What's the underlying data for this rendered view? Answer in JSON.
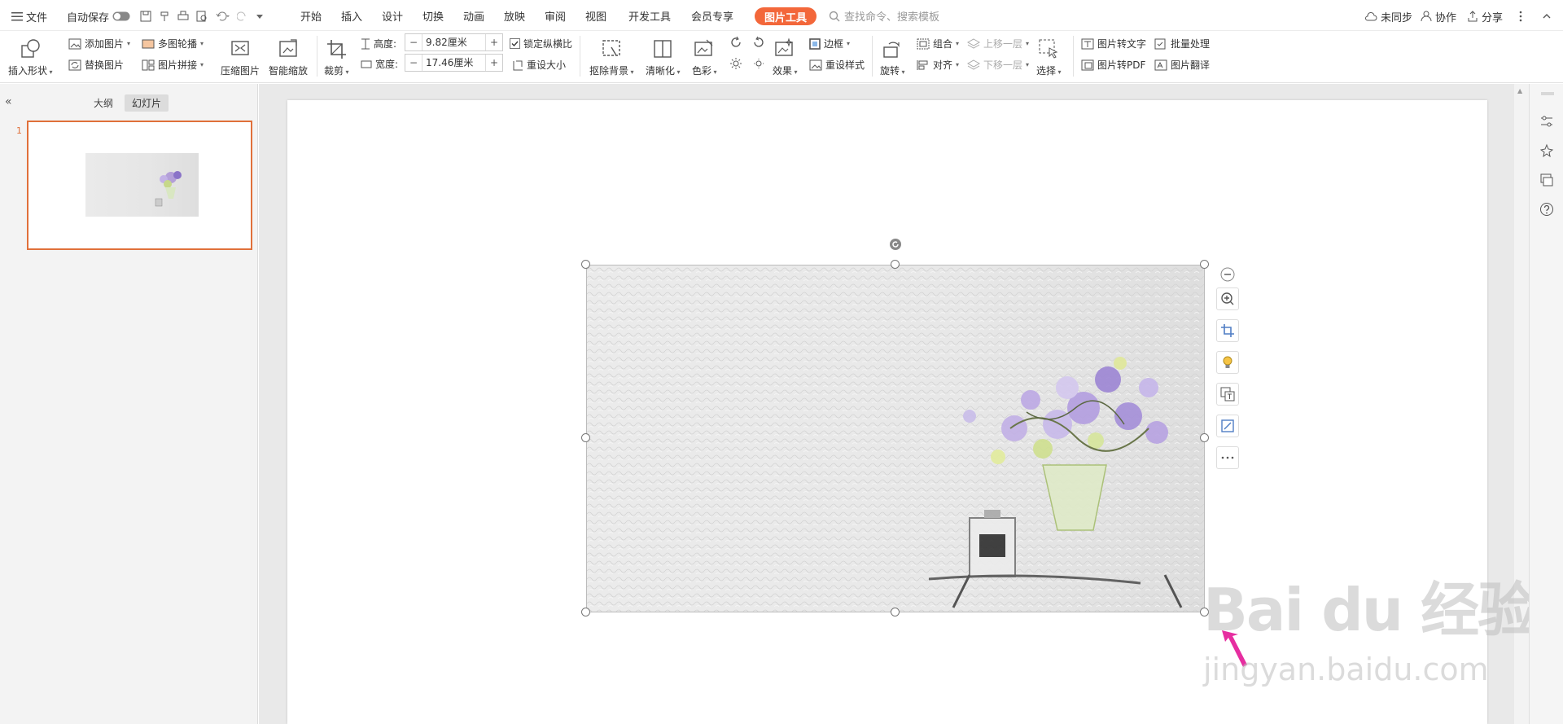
{
  "topbar": {
    "menu_label": "文件",
    "autosave_label": "自动保存",
    "tabs": [
      "开始",
      "插入",
      "设计",
      "切换",
      "动画",
      "放映",
      "审阅",
      "视图",
      "开发工具",
      "会员专享"
    ],
    "active_tab": "图片工具",
    "search_placeholder": "查找命令、搜索模板",
    "sync_label": "未同步",
    "collab_label": "协作",
    "share_label": "分享"
  },
  "ribbon": {
    "insert_shape": "插入形状",
    "add_picture": "添加图片",
    "replace_picture": "替换图片",
    "multi_carousel": "多图轮播",
    "picture_mosaic": "图片拼接",
    "compress": "压缩图片",
    "smart_scale": "智能缩放",
    "crop": "裁剪",
    "height_label": "高度:",
    "height_value": "9.82厘米",
    "width_label": "宽度:",
    "width_value": "17.46厘米",
    "lock_ratio": "锁定纵横比",
    "reset_size": "重设大小",
    "remove_bg": "抠除背景",
    "sharpen": "清晰化",
    "color": "色彩",
    "effects": "效果",
    "border": "边框",
    "reset_style": "重设样式",
    "rotate": "旋转",
    "group": "组合",
    "align": "对齐",
    "bring_forward": "上移一层",
    "send_backward": "下移一层",
    "select": "选择",
    "pic_to_text": "图片转文字",
    "batch": "批量处理",
    "pic_to_pdf": "图片转PDF",
    "pic_translate": "图片翻译"
  },
  "leftpanel": {
    "tab_outline": "大纲",
    "tab_slides": "幻灯片",
    "slide_number": "1"
  },
  "watermark": {
    "brand_text": "Bai du 经验",
    "url": "jingyan.baidu.com"
  },
  "colors": {
    "accent": "#f3673a",
    "selection": "#e0703a",
    "arrow": "#e62ea0"
  }
}
